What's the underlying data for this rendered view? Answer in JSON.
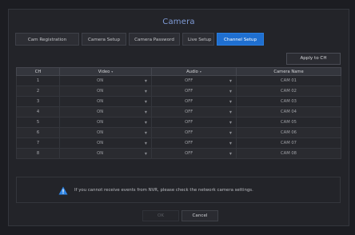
{
  "dialog": {
    "title": "Camera"
  },
  "tabs": [
    {
      "label": "Cam Registration",
      "active": false
    },
    {
      "label": "Camera Setup",
      "active": false
    },
    {
      "label": "Camera Password",
      "active": false
    },
    {
      "label": "Live Setup",
      "active": false
    },
    {
      "label": "Channel Setup",
      "active": true
    }
  ],
  "apply_button": "Apply to CH",
  "table": {
    "headers": {
      "ch": "CH",
      "video": "Video",
      "audio": "Audio",
      "camera_name": "Camera Name"
    },
    "rows": [
      {
        "ch": "1",
        "video": "ON",
        "audio": "OFF",
        "camera_name": "CAM 01"
      },
      {
        "ch": "2",
        "video": "ON",
        "audio": "OFF",
        "camera_name": "CAM 02"
      },
      {
        "ch": "3",
        "video": "ON",
        "audio": "OFF",
        "camera_name": "CAM 03"
      },
      {
        "ch": "4",
        "video": "ON",
        "audio": "OFF",
        "camera_name": "CAM 04"
      },
      {
        "ch": "5",
        "video": "ON",
        "audio": "OFF",
        "camera_name": "CAM 05"
      },
      {
        "ch": "6",
        "video": "ON",
        "audio": "OFF",
        "camera_name": "CAM 06"
      },
      {
        "ch": "7",
        "video": "ON",
        "audio": "OFF",
        "camera_name": "CAM 07"
      },
      {
        "ch": "8",
        "video": "ON",
        "audio": "OFF",
        "camera_name": "CAM 08"
      }
    ]
  },
  "notice": {
    "icon": "warning-icon",
    "text": "If you cannot receive events from NVR, please check the network camera settings."
  },
  "footer": {
    "ok_label": "OK",
    "cancel_label": "Cancel"
  },
  "colors": {
    "accent": "#1f6fd0",
    "title": "#7f9bd6",
    "warning": "#2f86e6",
    "background": "#1c1d22"
  }
}
